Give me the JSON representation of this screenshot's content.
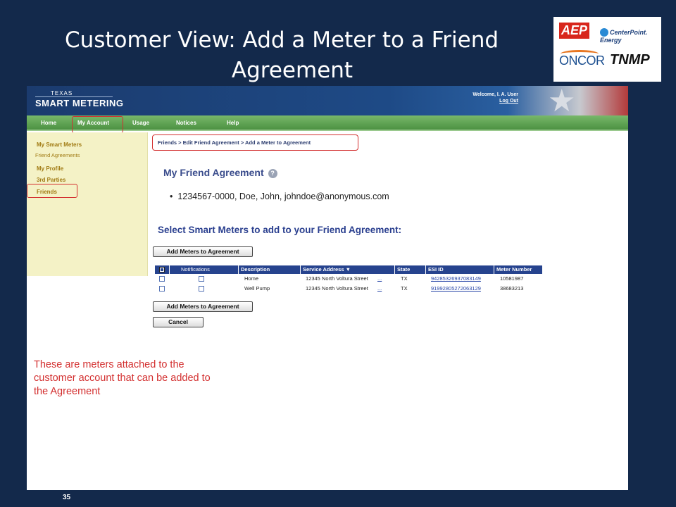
{
  "slide": {
    "title_line1": "Customer View:  Add a Meter to a Friend",
    "title_line2": "Agreement",
    "note": "These are meters attached to the customer account that can be added to the Agreement",
    "page_number": "35",
    "logos": [
      "AEP",
      "CenterPoint. Energy",
      "ONCOR",
      "TNMP"
    ]
  },
  "app": {
    "brand_small": "TEXAS",
    "brand": "SMART METERING",
    "welcome": "Welcome, I. A. User",
    "logout": "Log Out",
    "nav": [
      "Home",
      "My Account",
      "Usage",
      "Notices",
      "Help"
    ],
    "sidebar": {
      "my_smart_meters": "My Smart Meters",
      "friend_agreements": "Friend Agreements",
      "my_profile": "My Profile",
      "third_parties": "3rd Parties",
      "friends": "Friends"
    },
    "breadcrumb": "Friends > Edit Friend Agreement > Add a Meter to Agreement",
    "agreement_heading": "My Friend Agreement",
    "help_glyph": "?",
    "friend_entry": "1234567-0000,  Doe, John, johndoe@anonymous.com",
    "select_heading": "Select Smart Meters to add to your Friend Agreement:",
    "add_button": "Add Meters to Agreement",
    "cancel_button": "Cancel",
    "table": {
      "headers": {
        "notifications": "Notifications",
        "description": "Description",
        "service_address": "Service Address ▼",
        "state": "State",
        "esi_id": "ESI ID",
        "meter_number": "Meter Number"
      },
      "rows": [
        {
          "description": "Home",
          "address": "12345 North Voltura Street",
          "more": "...",
          "state": "TX",
          "esi_id": "94285326937083149",
          "meter_number": "10581987"
        },
        {
          "description": "Well Pump",
          "address": "12345 North Voltura Street",
          "more": "...",
          "state": "TX",
          "esi_id": "91992805272063129",
          "meter_number": "38683213"
        }
      ]
    }
  },
  "colors": {
    "slide_bg": "#13294b",
    "highlight": "#d32f2f",
    "nav_green": "#4c9142",
    "grid_header": "#26438e"
  }
}
